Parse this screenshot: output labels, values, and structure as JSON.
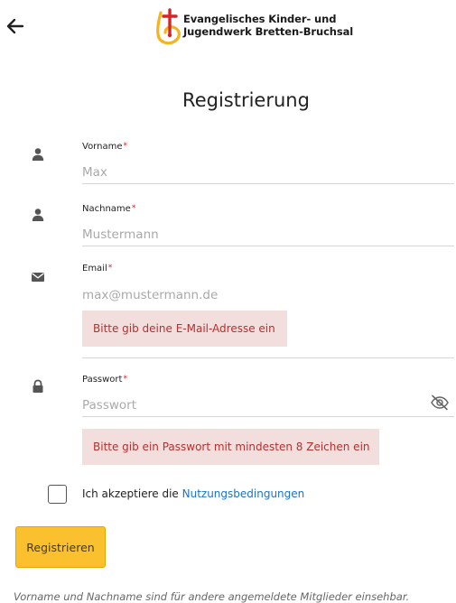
{
  "header": {
    "back_icon": "arrow-left-icon",
    "logo_icon": "cross-logo-icon",
    "org_line1": "Evangelisches Kinder- und",
    "org_line2": "Jugendwerk Bretten-Bruchsal"
  },
  "title": "Registrierung",
  "fields": {
    "vorname": {
      "label": "Vorname",
      "required_mark": "*",
      "placeholder": "Max",
      "icon": "user-icon"
    },
    "nachname": {
      "label": "Nachname",
      "required_mark": "*",
      "placeholder": "Mustermann",
      "icon": "user-icon"
    },
    "email": {
      "label": "Email",
      "required_mark": "*",
      "placeholder": "max@mustermann.de",
      "icon": "envelope-icon",
      "error": "Bitte gib deine E-Mail-Adresse ein"
    },
    "passwort": {
      "label": "Passwort",
      "required_mark": "*",
      "placeholder": "Passwort",
      "icon": "lock-icon",
      "toggle_icon": "eye-slash-icon",
      "error": "Bitte gib ein Passwort mit mindesten 8 Zeichen ein"
    }
  },
  "terms": {
    "checked": false,
    "text": "Ich akzeptiere die ",
    "link": "Nutzungsbedingungen"
  },
  "submit_label": "Registrieren",
  "footnote": "Vorname und Nachname sind für andere angemeldete Mitglieder einsehbar.",
  "colors": {
    "accent_button": "#fbc02d",
    "error_bg": "#f3dede",
    "error_text": "#b3312e",
    "link": "#1a73c9",
    "required": "#d12020"
  }
}
